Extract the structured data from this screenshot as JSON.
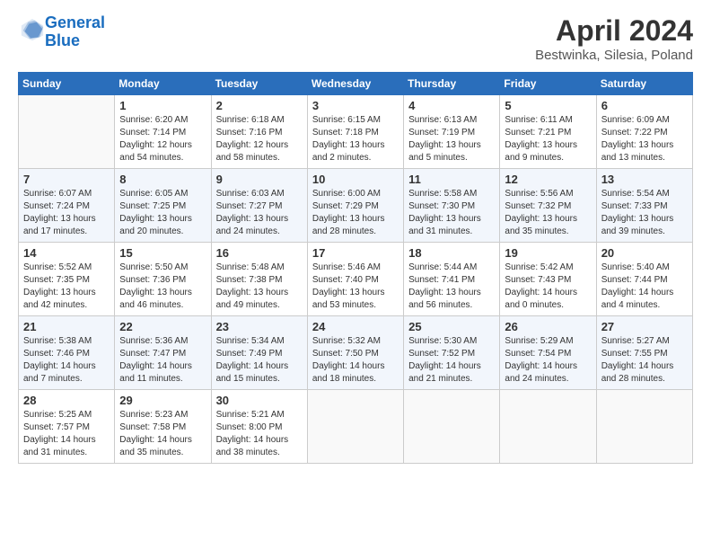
{
  "header": {
    "logo_line1": "General",
    "logo_line2": "Blue",
    "month": "April 2024",
    "location": "Bestwinka, Silesia, Poland"
  },
  "days_of_week": [
    "Sunday",
    "Monday",
    "Tuesday",
    "Wednesday",
    "Thursday",
    "Friday",
    "Saturday"
  ],
  "weeks": [
    [
      {
        "day": "",
        "info": ""
      },
      {
        "day": "1",
        "info": "Sunrise: 6:20 AM\nSunset: 7:14 PM\nDaylight: 12 hours\nand 54 minutes."
      },
      {
        "day": "2",
        "info": "Sunrise: 6:18 AM\nSunset: 7:16 PM\nDaylight: 12 hours\nand 58 minutes."
      },
      {
        "day": "3",
        "info": "Sunrise: 6:15 AM\nSunset: 7:18 PM\nDaylight: 13 hours\nand 2 minutes."
      },
      {
        "day": "4",
        "info": "Sunrise: 6:13 AM\nSunset: 7:19 PM\nDaylight: 13 hours\nand 5 minutes."
      },
      {
        "day": "5",
        "info": "Sunrise: 6:11 AM\nSunset: 7:21 PM\nDaylight: 13 hours\nand 9 minutes."
      },
      {
        "day": "6",
        "info": "Sunrise: 6:09 AM\nSunset: 7:22 PM\nDaylight: 13 hours\nand 13 minutes."
      }
    ],
    [
      {
        "day": "7",
        "info": "Sunrise: 6:07 AM\nSunset: 7:24 PM\nDaylight: 13 hours\nand 17 minutes."
      },
      {
        "day": "8",
        "info": "Sunrise: 6:05 AM\nSunset: 7:25 PM\nDaylight: 13 hours\nand 20 minutes."
      },
      {
        "day": "9",
        "info": "Sunrise: 6:03 AM\nSunset: 7:27 PM\nDaylight: 13 hours\nand 24 minutes."
      },
      {
        "day": "10",
        "info": "Sunrise: 6:00 AM\nSunset: 7:29 PM\nDaylight: 13 hours\nand 28 minutes."
      },
      {
        "day": "11",
        "info": "Sunrise: 5:58 AM\nSunset: 7:30 PM\nDaylight: 13 hours\nand 31 minutes."
      },
      {
        "day": "12",
        "info": "Sunrise: 5:56 AM\nSunset: 7:32 PM\nDaylight: 13 hours\nand 35 minutes."
      },
      {
        "day": "13",
        "info": "Sunrise: 5:54 AM\nSunset: 7:33 PM\nDaylight: 13 hours\nand 39 minutes."
      }
    ],
    [
      {
        "day": "14",
        "info": "Sunrise: 5:52 AM\nSunset: 7:35 PM\nDaylight: 13 hours\nand 42 minutes."
      },
      {
        "day": "15",
        "info": "Sunrise: 5:50 AM\nSunset: 7:36 PM\nDaylight: 13 hours\nand 46 minutes."
      },
      {
        "day": "16",
        "info": "Sunrise: 5:48 AM\nSunset: 7:38 PM\nDaylight: 13 hours\nand 49 minutes."
      },
      {
        "day": "17",
        "info": "Sunrise: 5:46 AM\nSunset: 7:40 PM\nDaylight: 13 hours\nand 53 minutes."
      },
      {
        "day": "18",
        "info": "Sunrise: 5:44 AM\nSunset: 7:41 PM\nDaylight: 13 hours\nand 56 minutes."
      },
      {
        "day": "19",
        "info": "Sunrise: 5:42 AM\nSunset: 7:43 PM\nDaylight: 14 hours\nand 0 minutes."
      },
      {
        "day": "20",
        "info": "Sunrise: 5:40 AM\nSunset: 7:44 PM\nDaylight: 14 hours\nand 4 minutes."
      }
    ],
    [
      {
        "day": "21",
        "info": "Sunrise: 5:38 AM\nSunset: 7:46 PM\nDaylight: 14 hours\nand 7 minutes."
      },
      {
        "day": "22",
        "info": "Sunrise: 5:36 AM\nSunset: 7:47 PM\nDaylight: 14 hours\nand 11 minutes."
      },
      {
        "day": "23",
        "info": "Sunrise: 5:34 AM\nSunset: 7:49 PM\nDaylight: 14 hours\nand 15 minutes."
      },
      {
        "day": "24",
        "info": "Sunrise: 5:32 AM\nSunset: 7:50 PM\nDaylight: 14 hours\nand 18 minutes."
      },
      {
        "day": "25",
        "info": "Sunrise: 5:30 AM\nSunset: 7:52 PM\nDaylight: 14 hours\nand 21 minutes."
      },
      {
        "day": "26",
        "info": "Sunrise: 5:29 AM\nSunset: 7:54 PM\nDaylight: 14 hours\nand 24 minutes."
      },
      {
        "day": "27",
        "info": "Sunrise: 5:27 AM\nSunset: 7:55 PM\nDaylight: 14 hours\nand 28 minutes."
      }
    ],
    [
      {
        "day": "28",
        "info": "Sunrise: 5:25 AM\nSunset: 7:57 PM\nDaylight: 14 hours\nand 31 minutes."
      },
      {
        "day": "29",
        "info": "Sunrise: 5:23 AM\nSunset: 7:58 PM\nDaylight: 14 hours\nand 35 minutes."
      },
      {
        "day": "30",
        "info": "Sunrise: 5:21 AM\nSunset: 8:00 PM\nDaylight: 14 hours\nand 38 minutes."
      },
      {
        "day": "",
        "info": ""
      },
      {
        "day": "",
        "info": ""
      },
      {
        "day": "",
        "info": ""
      },
      {
        "day": "",
        "info": ""
      }
    ]
  ]
}
